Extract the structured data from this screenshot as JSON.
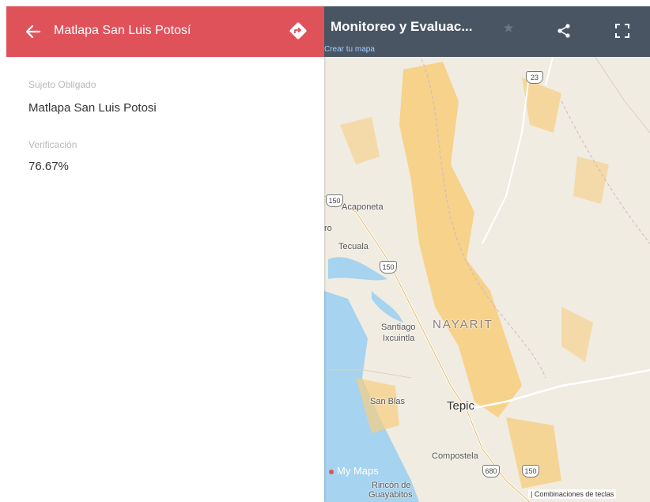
{
  "panel": {
    "title": "Matlapa San Luis Potosí",
    "fields": [
      {
        "label": "Sujeto Obligado",
        "value": "Matlapa San Luis Potosi"
      },
      {
        "label": "Verificación",
        "value": "76.67%"
      }
    ]
  },
  "map": {
    "title": "Monitoreo y Evaluac...",
    "create_link": "Crear tu mapa",
    "brand": "My Maps",
    "shortcuts": "| Combinaciones de teclas",
    "places": [
      "Acaponeta",
      "Tecuala",
      "Santiago",
      "Ixcuintla",
      "NAYARIT",
      "San Blas",
      "Tepic",
      "Compostela",
      "Rincón de",
      "Guayabitos",
      "ro"
    ],
    "routes": [
      "23",
      "150",
      "150",
      "680",
      "150"
    ]
  },
  "colors": {
    "header_red": "#e0525a",
    "map_header": "#4a5564",
    "water": "#a5d3f0",
    "land": "#f1ece1",
    "urban": "#f6cf82"
  },
  "icons": [
    "back-arrow-icon",
    "directions-icon",
    "star-icon",
    "share-icon",
    "fullscreen-icon"
  ]
}
